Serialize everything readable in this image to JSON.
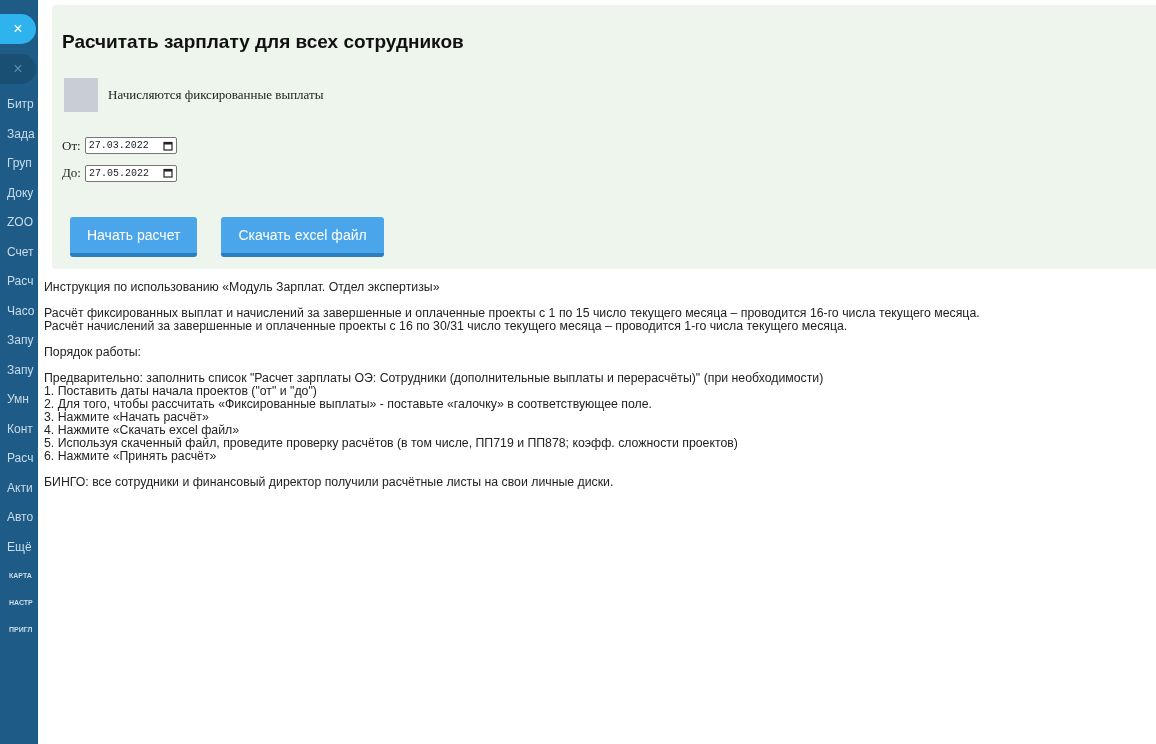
{
  "sidebar": {
    "close_buttons": [
      "×",
      "×"
    ],
    "items": [
      "Битр",
      "Зада",
      "Груп",
      "Доку",
      "ZOO",
      "Счет",
      "Расч",
      "Часо",
      "Запу",
      "Запу",
      "Умн",
      "Конт",
      "Расч",
      "Акти",
      "Авто",
      "Ещё"
    ],
    "footer_items": [
      "КАРТА",
      "НАСТР",
      "ПРИГЛ"
    ]
  },
  "panel": {
    "title": "Расчитать зарплату для всех сотрудников",
    "checkbox": {
      "label": "Начисляются фиксированные выплаты",
      "checked": false
    },
    "dates": [
      {
        "label": "От:",
        "value": "27.03.2022"
      },
      {
        "label": "До:",
        "value": "27.05.2022"
      }
    ],
    "buttons": [
      "Начать расчет",
      "Скачать excel файл"
    ]
  },
  "instructions": [
    [
      "Инструкция по использованию «Модуль Зарплат. Отдел экспертизы»"
    ],
    [
      "Расчёт фиксированных выплат и начислений за завершенные и оплаченные проекты с 1 по 15 число текущего месяца – проводится 16-го числа текущего месяца.",
      "Расчёт начислений за завершенные и оплаченные проекты с 16 по 30/31 число текущего месяца – проводится 1-го числа текущего месяца."
    ],
    [
      "Порядок работы:"
    ],
    [
      "Предварительно: заполнить список \"Расчет зарплаты ОЭ: Сотрудники (дополнительные выплаты и перерасчёты)\" (при необходимости)",
      "1. Поставить даты начала проектов (\"от\" и \"до\")",
      "2. Для того, чтобы рассчитать «Фиксированные выплаты» - поставьте «галочку» в соответствующее поле.",
      "3. Нажмите «Начать расчёт»",
      "4. Нажмите «Скачать excel файл»",
      "5. Используя скаченный файл, проведите проверку расчётов (в том числе, ПП719 и ПП878; коэфф. сложности проектов)",
      "6. Нажмите «Принять расчёт»"
    ],
    [
      "БИНГО: все сотрудники и финансовый директор получили расчётные листы на свои личные диски."
    ]
  ]
}
